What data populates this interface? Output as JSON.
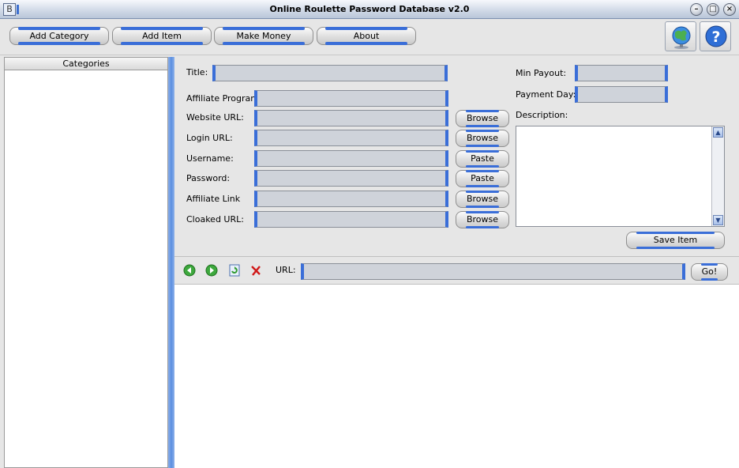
{
  "window": {
    "title": "Online Roulette Password Database v2.0",
    "app_icon_glyph": "B",
    "controls": {
      "minimize": "–",
      "maximize": "□",
      "close": "×"
    }
  },
  "toolbar": {
    "buttons": [
      {
        "label": "Add Category"
      },
      {
        "label": "Add Item"
      },
      {
        "label": "Make Money"
      },
      {
        "label": "About"
      }
    ],
    "icons": [
      "globe-icon",
      "help-icon"
    ],
    "help_glyph": "?"
  },
  "categories": {
    "header": "Categories",
    "items": []
  },
  "form": {
    "labels": {
      "title": "Title:",
      "affiliate_program": "Affiliate Program:",
      "website_url": "Website URL:",
      "login_url": "Login URL:",
      "username": "Username:",
      "password": "Password:",
      "affiliate_link": "Affiliate Link",
      "cloaked_url": "Cloaked URL:",
      "min_payout": "Min Payout:",
      "payment_day": "Payment Day:",
      "description": "Description:"
    },
    "values": {
      "title": "",
      "affiliate_program": "",
      "website_url": "",
      "login_url": "",
      "username": "",
      "password": "",
      "affiliate_link": "",
      "cloaked_url": "",
      "min_payout": "",
      "payment_day": "",
      "description": ""
    },
    "side_buttons": {
      "website_url": "Browse",
      "login_url": "Browse",
      "username": "Paste",
      "password": "Paste",
      "affiliate_link": "Browse",
      "cloaked_url": "Browse"
    },
    "save_label": "Save Item"
  },
  "navbar": {
    "url_label": "URL:",
    "url_value": "",
    "go_label": "Go!",
    "icons": [
      "back-icon",
      "forward-icon",
      "refresh-icon",
      "stop-icon"
    ]
  },
  "colors": {
    "accent": "#3a6ed8",
    "splitter": "#5b8fe0",
    "background": "#e6e6e6"
  }
}
